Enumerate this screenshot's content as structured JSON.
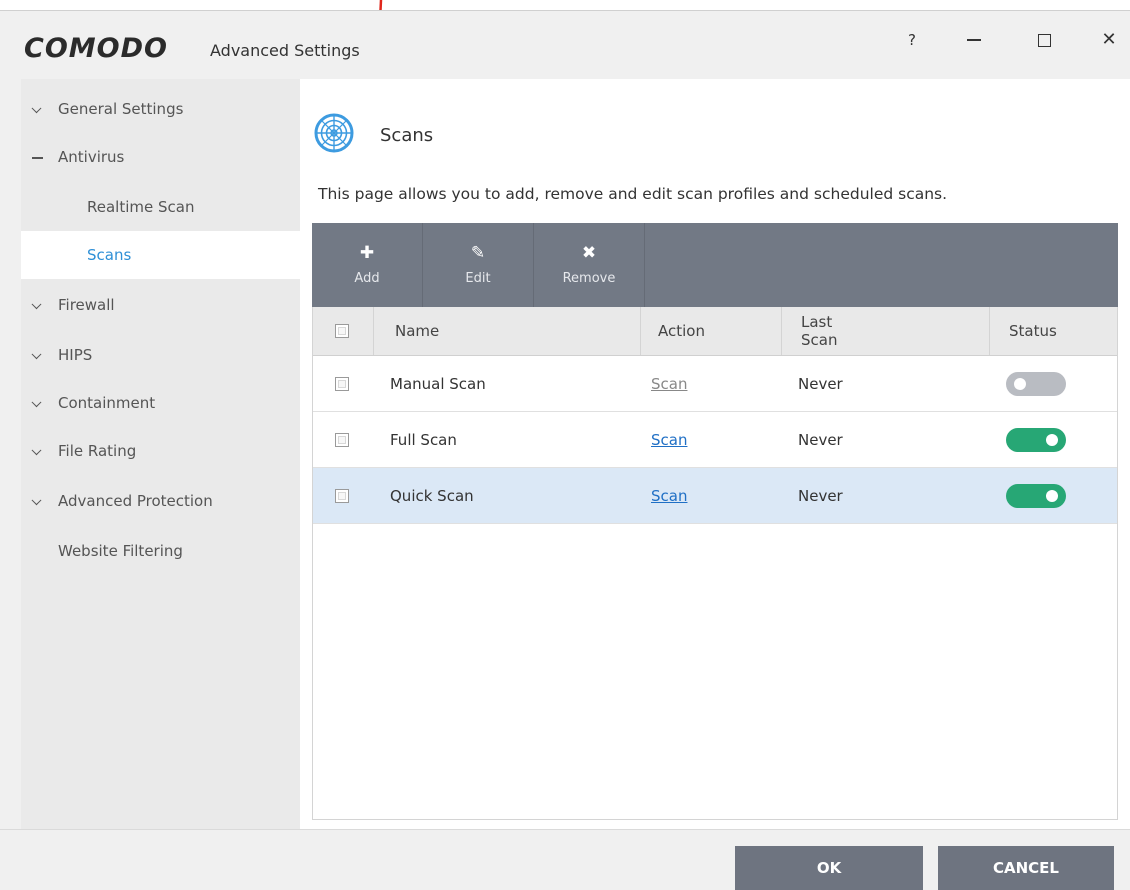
{
  "window": {
    "logo_text": "COMODO",
    "title": "Advanced Settings",
    "help_label": "?",
    "close_label": "✕"
  },
  "sidebar": {
    "items": [
      {
        "label": "General Settings",
        "expander": "chevron-down"
      },
      {
        "label": "Antivirus",
        "expander": "minus"
      },
      {
        "label": "Realtime Scan"
      },
      {
        "label": "Scans",
        "active": true
      },
      {
        "label": "Firewall",
        "expander": "chevron-down"
      },
      {
        "label": "HIPS",
        "expander": "chevron-down"
      },
      {
        "label": "Containment",
        "expander": "chevron-down"
      },
      {
        "label": "File Rating",
        "expander": "chevron-down"
      },
      {
        "label": "Advanced Protection",
        "expander": "chevron-down"
      },
      {
        "label": "Website Filtering"
      }
    ]
  },
  "page": {
    "title": "Scans",
    "description": "This page allows you to add, remove and edit scan profiles and scheduled scans.",
    "icon": "radar-scan-icon"
  },
  "toolbar": {
    "add_label": "Add",
    "edit_label": "Edit",
    "remove_label": "Remove"
  },
  "table": {
    "headers": {
      "name": "Name",
      "action": "Action",
      "last_scan": "Last Scan",
      "status": "Status"
    },
    "rows": [
      {
        "name": "Manual Scan",
        "action": "Scan",
        "last_scan": "Never",
        "status": "off",
        "action_enabled": false
      },
      {
        "name": "Full Scan",
        "action": "Scan",
        "last_scan": "Never",
        "status": "on",
        "action_enabled": true
      },
      {
        "name": "Quick Scan",
        "action": "Scan",
        "last_scan": "Never",
        "status": "on",
        "action_enabled": true,
        "selected": true
      }
    ]
  },
  "footer": {
    "ok_label": "OK",
    "cancel_label": "CANCEL"
  },
  "colors": {
    "accent": "#2e8fd6",
    "toolbar": "#727985",
    "toggle_on": "#27a775",
    "toggle_off": "#b9bcc2",
    "link": "#1f6fc5",
    "link_disabled": "#888888",
    "annotation_arrow": "#e0261b"
  }
}
